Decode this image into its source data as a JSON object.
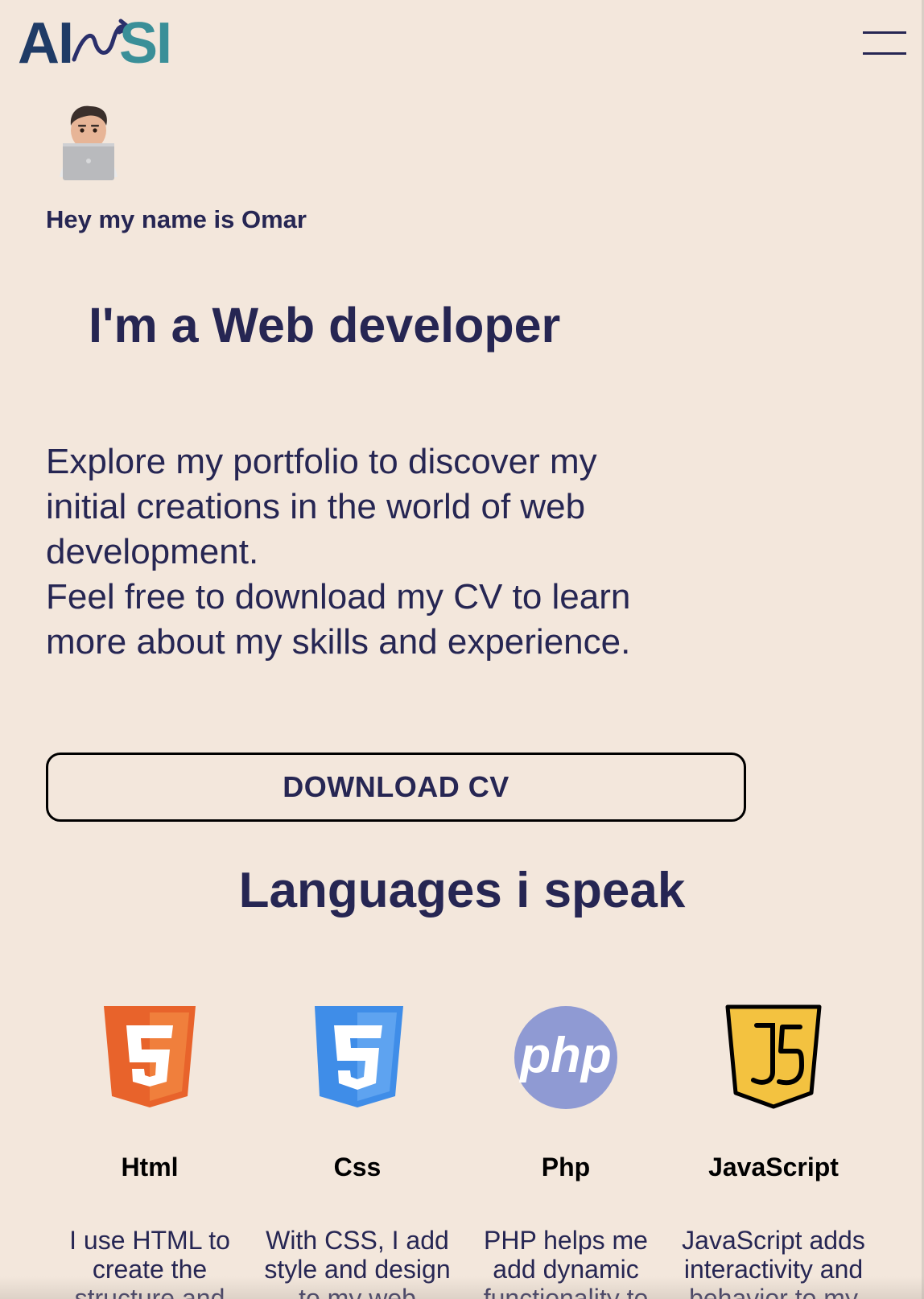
{
  "header": {
    "logo_text": "AISSI",
    "menu_icon": "hamburger-menu-icon"
  },
  "hero": {
    "avatar_icon": "memoji-laptop-avatar",
    "greeting": "Hey my name is Omar",
    "headline": "I'm a Web developer",
    "intro_lines": [
      "Explore my portfolio to discover my",
      "initial creations in the world of web",
      "development.",
      "Feel free to download my CV to learn",
      "more about my skills and experience."
    ],
    "download_label": "DOWNLOAD CV"
  },
  "languages": {
    "title": "Languages i speak",
    "items": [
      {
        "name": "Html",
        "icon": "html5-icon",
        "description": "I use HTML to create the structure and"
      },
      {
        "name": "Css",
        "icon": "css3-icon",
        "description": "With CSS, I add style and design to my web"
      },
      {
        "name": "Php",
        "icon": "php-icon",
        "description": "PHP helps me add dynamic functionality to"
      },
      {
        "name": "JavaScript",
        "icon": "javascript-icon",
        "description": "JavaScript adds interactivity and behavior to my"
      }
    ]
  },
  "colors": {
    "background": "#f3e7dc",
    "text": "#262653",
    "html_orange": "#e8632b",
    "css_blue": "#3f8de8",
    "php_purple": "#8f9ad3",
    "js_yellow": "#f3c240"
  }
}
